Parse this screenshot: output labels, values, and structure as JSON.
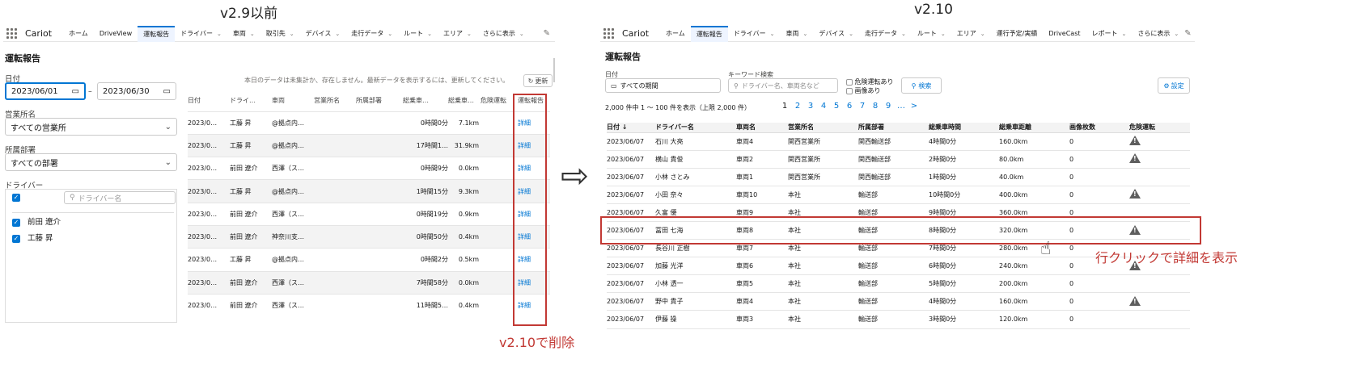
{
  "captions": {
    "left": "v2.9以前",
    "right": "v2.10"
  },
  "arrow": "⇨",
  "annotations": {
    "deleted": "v2.10で削除",
    "row_click": "行クリックで詳細を表示"
  },
  "old": {
    "app_name": "Cariot",
    "nav": [
      {
        "label": "ホーム",
        "chevron": false
      },
      {
        "label": "DriveView",
        "chevron": false
      },
      {
        "label": "運転報告",
        "chevron": false,
        "active": true
      },
      {
        "label": "ドライバー",
        "chevron": true
      },
      {
        "label": "車両",
        "chevron": true
      },
      {
        "label": "取引先",
        "chevron": true
      },
      {
        "label": "デバイス",
        "chevron": true
      },
      {
        "label": "走行データ",
        "chevron": true
      },
      {
        "label": "ルート",
        "chevron": true
      },
      {
        "label": "エリア",
        "chevron": true
      },
      {
        "label": "さらに表示",
        "chevron": true
      }
    ],
    "title": "運転報告",
    "date_label": "日付",
    "date_from": "2023/06/01",
    "date_sep": "–",
    "date_to": "2023/06/30",
    "office_label": "営業所名",
    "office_value": "すべての営業所",
    "dept_label": "所属部署",
    "dept_value": "すべての部署",
    "driver_label": "ドライバー",
    "driver_search_placeholder": "ドライバー名",
    "drivers": [
      "前田 遼介",
      "工藤 昇"
    ],
    "notice": "本日のデータは未集計か、存在しません。最新データを表示するには、更新してください。",
    "refresh": "更新",
    "columns": [
      "日付",
      "ドライ…",
      "車両",
      "営業所名",
      "所属部署",
      "総乗車…",
      "総乗車…",
      "危険運転",
      "運転報告"
    ],
    "rows": [
      [
        "2023/0…",
        "工藤 昇",
        "@拠点内…",
        "",
        "",
        "0時間0分",
        "7.1km",
        "",
        "詳細"
      ],
      [
        "2023/0…",
        "工藤 昇",
        "@拠点内…",
        "",
        "",
        "17時間1…",
        "31.9km",
        "",
        "詳細"
      ],
      [
        "2023/0…",
        "前田 遼介",
        "西澤（ス…",
        "",
        "",
        "0時間9分",
        "0.0km",
        "",
        "詳細"
      ],
      [
        "2023/0…",
        "工藤 昇",
        "@拠点内…",
        "",
        "",
        "1時間15分",
        "9.3km",
        "",
        "詳細"
      ],
      [
        "2023/0…",
        "前田 遼介",
        "西澤（ス…",
        "",
        "",
        "0時間19分",
        "0.9km",
        "",
        "詳細"
      ],
      [
        "2023/0…",
        "前田 遼介",
        "神奈川支…",
        "",
        "",
        "0時間50分",
        "0.4km",
        "",
        "詳細"
      ],
      [
        "2023/0…",
        "工藤 昇",
        "@拠点内…",
        "",
        "",
        "0時間2分",
        "0.5km",
        "",
        "詳細"
      ],
      [
        "2023/0…",
        "前田 遼介",
        "西澤（ス…",
        "",
        "",
        "7時間58分",
        "0.0km",
        "",
        "詳細"
      ],
      [
        "2023/0…",
        "前田 遼介",
        "西澤（ス…",
        "",
        "",
        "11時間5…",
        "0.4km",
        "",
        "詳細"
      ]
    ]
  },
  "new": {
    "app_name": "Cariot",
    "nav": [
      {
        "label": "ホーム",
        "chevron": false
      },
      {
        "label": "運転報告",
        "chevron": false,
        "active": true
      },
      {
        "label": "ドライバー",
        "chevron": true
      },
      {
        "label": "車両",
        "chevron": true
      },
      {
        "label": "デバイス",
        "chevron": true
      },
      {
        "label": "走行データ",
        "chevron": true
      },
      {
        "label": "ルート",
        "chevron": true
      },
      {
        "label": "エリア",
        "chevron": true
      },
      {
        "label": "運行予定/実績",
        "chevron": false
      },
      {
        "label": "DriveCast",
        "chevron": false
      },
      {
        "label": "レポート",
        "chevron": true
      },
      {
        "label": "さらに表示",
        "chevron": true
      }
    ],
    "title": "運転報告",
    "date_label": "日付",
    "date_value": "すべての期間",
    "keyword_label": "キーワード検索",
    "keyword_placeholder": "ドライバー名、車両名など",
    "chk_danger": "危険運転あり",
    "chk_image": "画像あり",
    "search_btn": "検索",
    "settings_btn": "設定",
    "count": "2,000 件中 1 ～ 100 件を表示（上限 2,000 件）",
    "pages": [
      "1",
      "2",
      "3",
      "4",
      "5",
      "6",
      "7",
      "8",
      "9",
      "…",
      ">"
    ],
    "columns": [
      "日付 ↓",
      "ドライバー名",
      "車両名",
      "営業所名",
      "所属部署",
      "総乗車時間",
      "総乗車距離",
      "画像枚数",
      "危険運転"
    ],
    "rows": [
      {
        "cells": [
          "2023/06/07",
          "石川 大亮",
          "車両4",
          "関西営業所",
          "関西輸送部",
          "4時間0分",
          "160.0km",
          "0"
        ],
        "warn": true
      },
      {
        "cells": [
          "2023/06/07",
          "横山 貴俊",
          "車両2",
          "関西営業所",
          "関西輸送部",
          "2時間0分",
          "80.0km",
          "0"
        ],
        "warn": true
      },
      {
        "cells": [
          "2023/06/07",
          "小林 さとみ",
          "車両1",
          "関西営業所",
          "関西輸送部",
          "1時間0分",
          "40.0km",
          "0"
        ],
        "warn": false
      },
      {
        "cells": [
          "2023/06/07",
          "小田 奈々",
          "車両10",
          "本社",
          "輸送部",
          "10時間0分",
          "400.0km",
          "0"
        ],
        "warn": true
      },
      {
        "cells": [
          "2023/06/07",
          "久富 優",
          "車両9",
          "本社",
          "輸送部",
          "9時間0分",
          "360.0km",
          "0"
        ],
        "warn": false
      },
      {
        "cells": [
          "2023/06/07",
          "冨田 七海",
          "車両8",
          "本社",
          "輸送部",
          "8時間0分",
          "320.0km",
          "0"
        ],
        "warn": true
      },
      {
        "cells": [
          "2023/06/07",
          "長谷川 正樹",
          "車両7",
          "本社",
          "輸送部",
          "7時間0分",
          "280.0km",
          "0"
        ],
        "warn": false
      },
      {
        "cells": [
          "2023/06/07",
          "加藤 光洋",
          "車両6",
          "本社",
          "輸送部",
          "6時間0分",
          "240.0km",
          "0"
        ],
        "warn": true
      },
      {
        "cells": [
          "2023/06/07",
          "小林 透一",
          "車両5",
          "本社",
          "輸送部",
          "5時間0分",
          "200.0km",
          "0"
        ],
        "warn": false
      },
      {
        "cells": [
          "2023/06/07",
          "野中 貴子",
          "車両4",
          "本社",
          "輸送部",
          "4時間0分",
          "160.0km",
          "0"
        ],
        "warn": true
      },
      {
        "cells": [
          "2023/06/07",
          "伊藤 操",
          "車両3",
          "本社",
          "輸送部",
          "3時間0分",
          "120.0km",
          "0"
        ],
        "warn": false
      }
    ]
  }
}
